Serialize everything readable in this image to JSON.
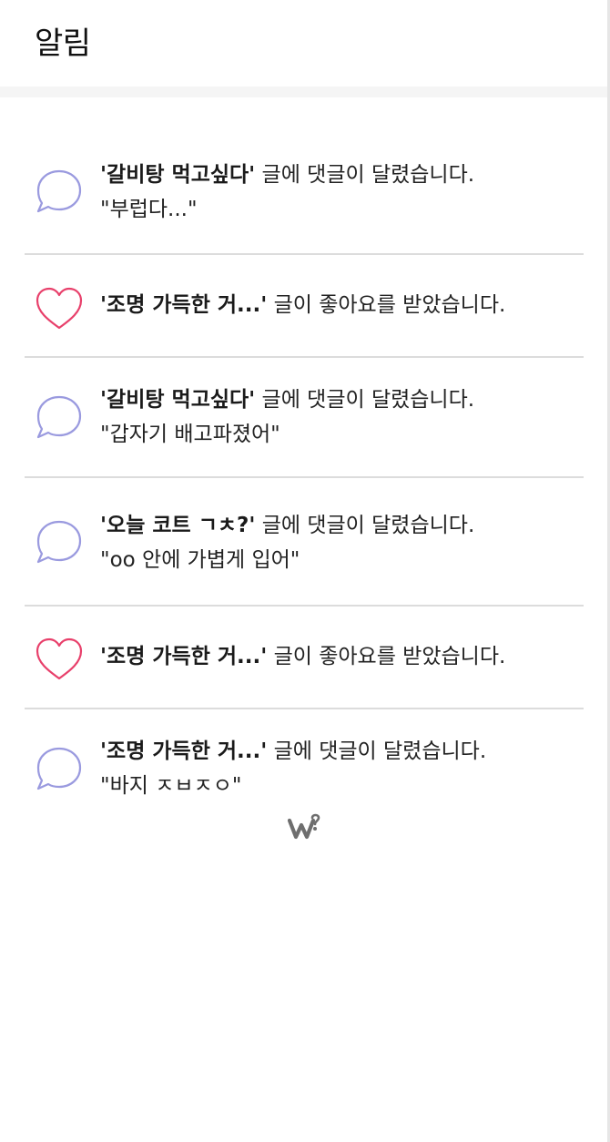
{
  "header": {
    "title": "알림"
  },
  "notifications": [
    {
      "type": "comment",
      "icon": "speech-bubble-icon",
      "post_title": "'갈비탕 먹고싶다'",
      "message": " 글에 댓글이 달렸습니다.",
      "quote": "\"부럽다...\""
    },
    {
      "type": "like",
      "icon": "heart-icon",
      "post_title": "'조명 가득한 거...'",
      "message": " 글이 좋아요를 받았습니다.",
      "quote": ""
    },
    {
      "type": "comment",
      "icon": "speech-bubble-icon",
      "post_title": "'갈비탕 먹고싶다'",
      "message": " 글에 댓글이 달렸습니다.",
      "quote": "\"갑자기 배고파졌어\""
    },
    {
      "type": "comment",
      "icon": "speech-bubble-icon",
      "post_title": "'오늘 코트 ㄱㅊ?'",
      "message": " 글에 댓글이 달렸습니다.",
      "quote": "\"oo 안에 가볍게 입어\""
    },
    {
      "type": "like",
      "icon": "heart-icon",
      "post_title": "'조명 가득한 거...'",
      "message": " 글이 좋아요를 받았습니다.",
      "quote": ""
    },
    {
      "type": "comment",
      "icon": "speech-bubble-icon",
      "post_title": "'조명 가득한 거...'",
      "message": " 글에 댓글이 달렸습니다.",
      "quote": "\"바지 ㅈㅂㅈㅇ\""
    }
  ],
  "footer": {
    "logo_icon": "w-brand-logo-icon"
  },
  "colors": {
    "comment_icon": "#9a9adf",
    "like_icon": "#e8406b",
    "divider": "#dcdcdc",
    "header_gap": "#f5f5f5",
    "logo": "#6e6e6e"
  }
}
